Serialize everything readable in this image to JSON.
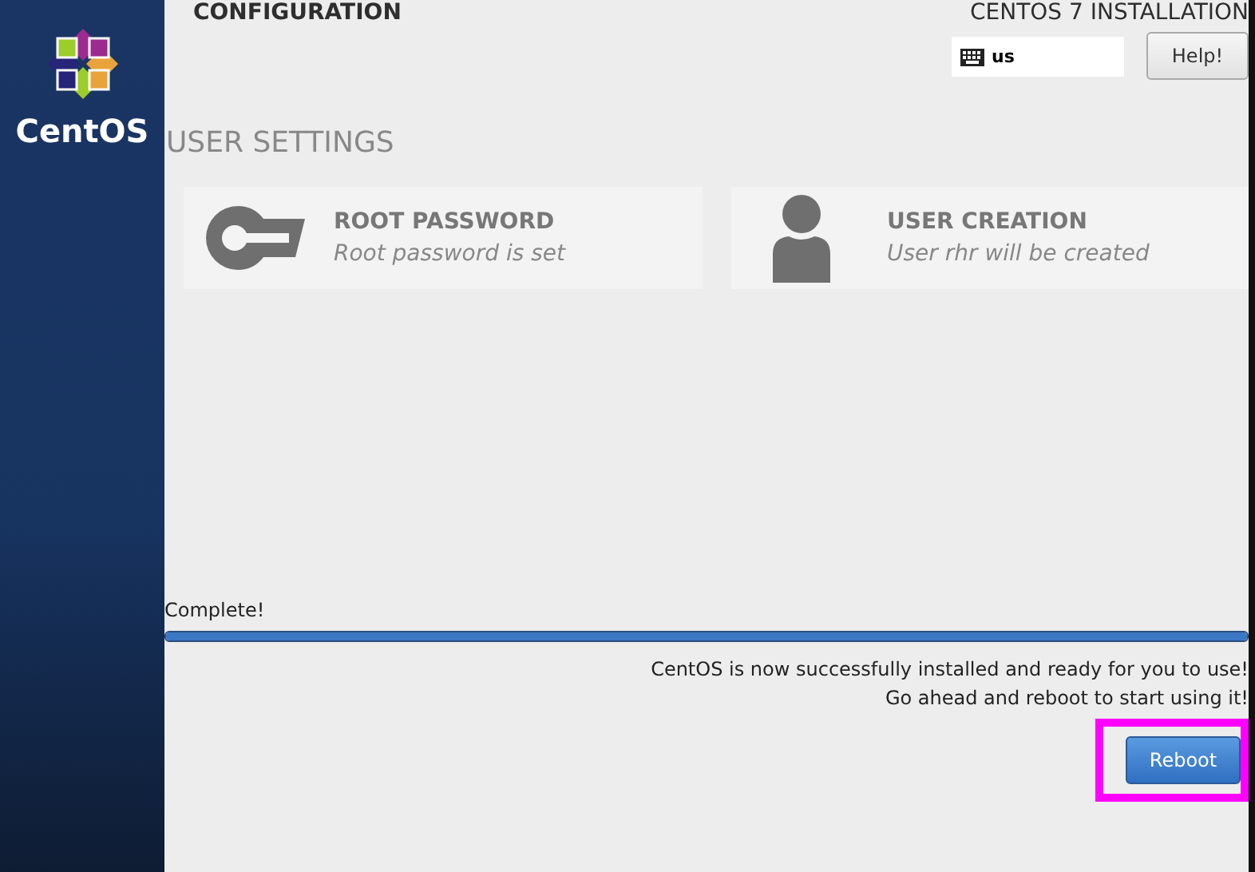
{
  "sidebar": {
    "logo_text": "CentOS"
  },
  "header": {
    "title": "CONFIGURATION",
    "product": "CENTOS 7 INSTALLATION",
    "keyboard_layout": "us",
    "help_button": "Help!"
  },
  "section": {
    "title": "USER SETTINGS"
  },
  "spokes": [
    {
      "kind": "key",
      "title": "ROOT PASSWORD",
      "status": "Root password is set"
    },
    {
      "kind": "user",
      "title": "USER CREATION",
      "status": "User rhr will be created"
    }
  ],
  "progress": {
    "label": "Complete!",
    "level": 1
  },
  "messages": [
    "CentOS is now successfully installed and ready for you to use!",
    "Go ahead and reboot to start using it!"
  ],
  "reboot_button": "Reboot",
  "highlight": {
    "color": "#ff00ff"
  }
}
